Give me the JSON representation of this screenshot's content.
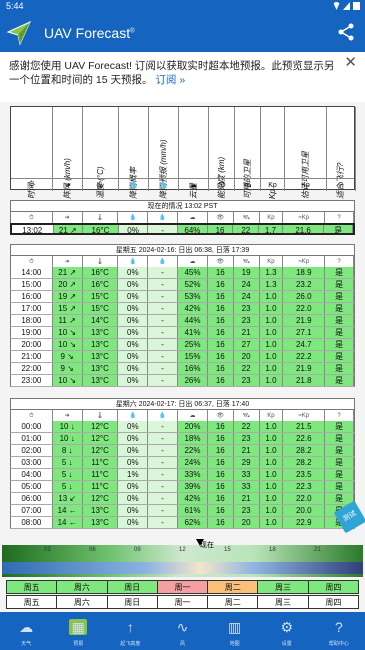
{
  "status": {
    "time": "5:44"
  },
  "app": {
    "title": "UAV Forecast"
  },
  "banner": {
    "text": "感谢您使用 UAV Forecast! 订阅以获取实时超本地预报。此预览显示另一个位置和时间的 15 天预报。",
    "link": "订阅 »"
  },
  "header_columns": [
    {
      "label": "时间",
      "symbol": "⏱"
    },
    {
      "label": "阵风 (km/h)",
      "symbol": "➜"
    },
    {
      "label": "温度 (°C)",
      "symbol": "🌡"
    },
    {
      "label": "降雨概率",
      "symbol": "💧"
    },
    {
      "label": "降雨预报 (mm/h)",
      "symbol": "💧"
    },
    {
      "label": "云量",
      "symbol": "☁"
    },
    {
      "label": "能见度 (km)",
      "symbol": "👁"
    },
    {
      "label": "可用的卫星",
      "symbol": "🛰"
    },
    {
      "label": "Kp",
      "symbol": "Kp"
    },
    {
      "label": "估计可用卫星",
      "symbol": "Kp"
    },
    {
      "label": "适合飞行?",
      "symbol": "?"
    }
  ],
  "current": {
    "title": "现在的情况 13:02 PST",
    "symbols": [
      "⏱",
      "➜",
      "🌡",
      "💧",
      "💧",
      "☁",
      "👁",
      "🛰",
      "Kp",
      "≈Kp",
      "?"
    ],
    "row": [
      "13:02",
      "21 ↗",
      "16°C",
      "0%",
      "-",
      "64%",
      "16",
      "22",
      "1.7",
      "21.6",
      "是"
    ]
  },
  "day1": {
    "title": "星期五 2024-02-16: 日出 06:38, 日落 17:39",
    "symbols": [
      "⏱",
      "➜",
      "🌡",
      "💧",
      "💧",
      "☁",
      "👁",
      "🛰",
      "Kp",
      "≈Kp",
      "?"
    ],
    "rows": [
      [
        "14:00",
        "21 ↗",
        "16°C",
        "0%",
        "-",
        "45%",
        "16",
        "19",
        "1.3",
        "18.9",
        "是"
      ],
      [
        "15:00",
        "20 ↗",
        "16°C",
        "0%",
        "-",
        "52%",
        "16",
        "24",
        "1.3",
        "23.2",
        "是"
      ],
      [
        "16:00",
        "19 ↗",
        "15°C",
        "0%",
        "-",
        "53%",
        "16",
        "24",
        "1.0",
        "26.0",
        "是"
      ],
      [
        "17:00",
        "15 ↗",
        "15°C",
        "0%",
        "-",
        "42%",
        "16",
        "23",
        "1.0",
        "22.0",
        "是"
      ],
      [
        "18:00",
        "11 ↗",
        "14°C",
        "0%",
        "-",
        "44%",
        "16",
        "23",
        "1.0",
        "21.9",
        "是"
      ],
      [
        "19:00",
        "10 ↘",
        "13°C",
        "0%",
        "-",
        "41%",
        "16",
        "21",
        "1.0",
        "27.1",
        "是"
      ],
      [
        "20:00",
        "10 ↘",
        "13°C",
        "0%",
        "-",
        "25%",
        "16",
        "27",
        "1.0",
        "24.7",
        "是"
      ],
      [
        "21:00",
        "9 ↘",
        "13°C",
        "0%",
        "-",
        "15%",
        "16",
        "20",
        "1.0",
        "22.2",
        "是"
      ],
      [
        "22:00",
        "9 ↘",
        "13°C",
        "0%",
        "-",
        "16%",
        "16",
        "22",
        "1.0",
        "21.9",
        "是"
      ],
      [
        "23:00",
        "10 ↘",
        "13°C",
        "0%",
        "-",
        "26%",
        "16",
        "23",
        "1.0",
        "21.8",
        "是"
      ]
    ]
  },
  "day2": {
    "title": "星期六 2024-02-17: 日出 06:37, 日落 17:40",
    "symbols": [
      "⏱",
      "➜",
      "🌡",
      "💧",
      "💧",
      "☁",
      "👁",
      "🛰",
      "Kp",
      "≈Kp",
      "?"
    ],
    "rows": [
      [
        "00:00",
        "10 ↓",
        "12°C",
        "0%",
        "-",
        "20%",
        "16",
        "22",
        "1.0",
        "21.5",
        "是"
      ],
      [
        "01:00",
        "10 ↓",
        "12°C",
        "0%",
        "-",
        "18%",
        "16",
        "23",
        "1.0",
        "22.6",
        "是"
      ],
      [
        "02:00",
        "8 ↓",
        "12°C",
        "0%",
        "-",
        "22%",
        "16",
        "21",
        "1.0",
        "28.2",
        "是"
      ],
      [
        "03:00",
        "5 ↓",
        "11°C",
        "0%",
        "-",
        "24%",
        "16",
        "29",
        "1.0",
        "28.2",
        "是"
      ],
      [
        "04:00",
        "5 ↓",
        "11°C",
        "1%",
        "-",
        "33%",
        "16",
        "33",
        "1.0",
        "23.5",
        "是"
      ],
      [
        "05:00",
        "5 ↓",
        "11°C",
        "0%",
        "-",
        "39%",
        "16",
        "33",
        "1.0",
        "22.3",
        "是"
      ],
      [
        "06:00",
        "13 ↙",
        "12°C",
        "0%",
        "-",
        "42%",
        "16",
        "21",
        "1.0",
        "22.0",
        "是"
      ],
      [
        "07:00",
        "14 ←",
        "13°C",
        "0%",
        "-",
        "61%",
        "16",
        "23",
        "1.0",
        "20.0",
        "是"
      ],
      [
        "08:00",
        "14 ←",
        "13°C",
        "0%",
        "-",
        "62%",
        "16",
        "20",
        "1.0",
        "22.9",
        "是"
      ]
    ]
  },
  "timeline": {
    "ticks": [
      "03",
      "06",
      "09",
      "12",
      "15",
      "18",
      "21"
    ],
    "now_label": "现在"
  },
  "day_tabs_1": [
    "周五",
    "周六",
    "周日",
    "周一",
    "周二",
    "周三",
    "周四"
  ],
  "day_tabs_2": [
    "周五",
    "周六",
    "周日",
    "周一",
    "周二",
    "周三",
    "周四"
  ],
  "fab_label": "测试",
  "nav": [
    {
      "label": "天气",
      "icon": "weather-icon"
    },
    {
      "label": "预报",
      "icon": "calendar-icon"
    },
    {
      "label": "起飞高度",
      "icon": "arrow-up-icon"
    },
    {
      "label": "风",
      "icon": "pulse-icon"
    },
    {
      "label": "地图",
      "icon": "map-icon"
    },
    {
      "label": "设置",
      "icon": "gear-icon"
    },
    {
      "label": "帮助中心",
      "icon": "help-icon"
    }
  ],
  "colors": {
    "primary": "#1565c0",
    "good": "#7ee87e",
    "warn": "#f4a0a0",
    "ok": "#f9c07a"
  }
}
